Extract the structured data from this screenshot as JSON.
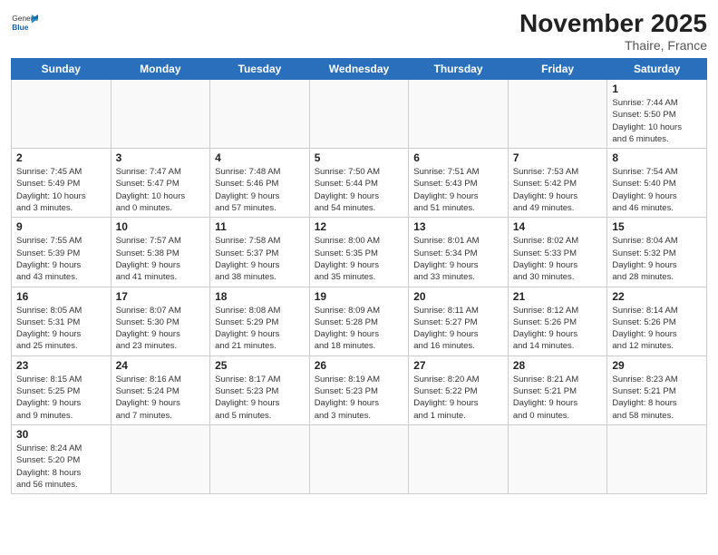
{
  "header": {
    "logo_general": "General",
    "logo_blue": "Blue",
    "month_title": "November 2025",
    "location": "Thaire, France"
  },
  "days_of_week": [
    "Sunday",
    "Monday",
    "Tuesday",
    "Wednesday",
    "Thursday",
    "Friday",
    "Saturday"
  ],
  "weeks": [
    [
      {
        "day": "",
        "info": ""
      },
      {
        "day": "",
        "info": ""
      },
      {
        "day": "",
        "info": ""
      },
      {
        "day": "",
        "info": ""
      },
      {
        "day": "",
        "info": ""
      },
      {
        "day": "",
        "info": ""
      },
      {
        "day": "1",
        "info": "Sunrise: 7:44 AM\nSunset: 5:50 PM\nDaylight: 10 hours\nand 6 minutes."
      }
    ],
    [
      {
        "day": "2",
        "info": "Sunrise: 7:45 AM\nSunset: 5:49 PM\nDaylight: 10 hours\nand 3 minutes."
      },
      {
        "day": "3",
        "info": "Sunrise: 7:47 AM\nSunset: 5:47 PM\nDaylight: 10 hours\nand 0 minutes."
      },
      {
        "day": "4",
        "info": "Sunrise: 7:48 AM\nSunset: 5:46 PM\nDaylight: 9 hours\nand 57 minutes."
      },
      {
        "day": "5",
        "info": "Sunrise: 7:50 AM\nSunset: 5:44 PM\nDaylight: 9 hours\nand 54 minutes."
      },
      {
        "day": "6",
        "info": "Sunrise: 7:51 AM\nSunset: 5:43 PM\nDaylight: 9 hours\nand 51 minutes."
      },
      {
        "day": "7",
        "info": "Sunrise: 7:53 AM\nSunset: 5:42 PM\nDaylight: 9 hours\nand 49 minutes."
      },
      {
        "day": "8",
        "info": "Sunrise: 7:54 AM\nSunset: 5:40 PM\nDaylight: 9 hours\nand 46 minutes."
      }
    ],
    [
      {
        "day": "9",
        "info": "Sunrise: 7:55 AM\nSunset: 5:39 PM\nDaylight: 9 hours\nand 43 minutes."
      },
      {
        "day": "10",
        "info": "Sunrise: 7:57 AM\nSunset: 5:38 PM\nDaylight: 9 hours\nand 41 minutes."
      },
      {
        "day": "11",
        "info": "Sunrise: 7:58 AM\nSunset: 5:37 PM\nDaylight: 9 hours\nand 38 minutes."
      },
      {
        "day": "12",
        "info": "Sunrise: 8:00 AM\nSunset: 5:35 PM\nDaylight: 9 hours\nand 35 minutes."
      },
      {
        "day": "13",
        "info": "Sunrise: 8:01 AM\nSunset: 5:34 PM\nDaylight: 9 hours\nand 33 minutes."
      },
      {
        "day": "14",
        "info": "Sunrise: 8:02 AM\nSunset: 5:33 PM\nDaylight: 9 hours\nand 30 minutes."
      },
      {
        "day": "15",
        "info": "Sunrise: 8:04 AM\nSunset: 5:32 PM\nDaylight: 9 hours\nand 28 minutes."
      }
    ],
    [
      {
        "day": "16",
        "info": "Sunrise: 8:05 AM\nSunset: 5:31 PM\nDaylight: 9 hours\nand 25 minutes."
      },
      {
        "day": "17",
        "info": "Sunrise: 8:07 AM\nSunset: 5:30 PM\nDaylight: 9 hours\nand 23 minutes."
      },
      {
        "day": "18",
        "info": "Sunrise: 8:08 AM\nSunset: 5:29 PM\nDaylight: 9 hours\nand 21 minutes."
      },
      {
        "day": "19",
        "info": "Sunrise: 8:09 AM\nSunset: 5:28 PM\nDaylight: 9 hours\nand 18 minutes."
      },
      {
        "day": "20",
        "info": "Sunrise: 8:11 AM\nSunset: 5:27 PM\nDaylight: 9 hours\nand 16 minutes."
      },
      {
        "day": "21",
        "info": "Sunrise: 8:12 AM\nSunset: 5:26 PM\nDaylight: 9 hours\nand 14 minutes."
      },
      {
        "day": "22",
        "info": "Sunrise: 8:14 AM\nSunset: 5:26 PM\nDaylight: 9 hours\nand 12 minutes."
      }
    ],
    [
      {
        "day": "23",
        "info": "Sunrise: 8:15 AM\nSunset: 5:25 PM\nDaylight: 9 hours\nand 9 minutes."
      },
      {
        "day": "24",
        "info": "Sunrise: 8:16 AM\nSunset: 5:24 PM\nDaylight: 9 hours\nand 7 minutes."
      },
      {
        "day": "25",
        "info": "Sunrise: 8:17 AM\nSunset: 5:23 PM\nDaylight: 9 hours\nand 5 minutes."
      },
      {
        "day": "26",
        "info": "Sunrise: 8:19 AM\nSunset: 5:23 PM\nDaylight: 9 hours\nand 3 minutes."
      },
      {
        "day": "27",
        "info": "Sunrise: 8:20 AM\nSunset: 5:22 PM\nDaylight: 9 hours\nand 1 minute."
      },
      {
        "day": "28",
        "info": "Sunrise: 8:21 AM\nSunset: 5:21 PM\nDaylight: 9 hours\nand 0 minutes."
      },
      {
        "day": "29",
        "info": "Sunrise: 8:23 AM\nSunset: 5:21 PM\nDaylight: 8 hours\nand 58 minutes."
      }
    ],
    [
      {
        "day": "30",
        "info": "Sunrise: 8:24 AM\nSunset: 5:20 PM\nDaylight: 8 hours\nand 56 minutes."
      },
      {
        "day": "",
        "info": ""
      },
      {
        "day": "",
        "info": ""
      },
      {
        "day": "",
        "info": ""
      },
      {
        "day": "",
        "info": ""
      },
      {
        "day": "",
        "info": ""
      },
      {
        "day": "",
        "info": ""
      }
    ]
  ]
}
